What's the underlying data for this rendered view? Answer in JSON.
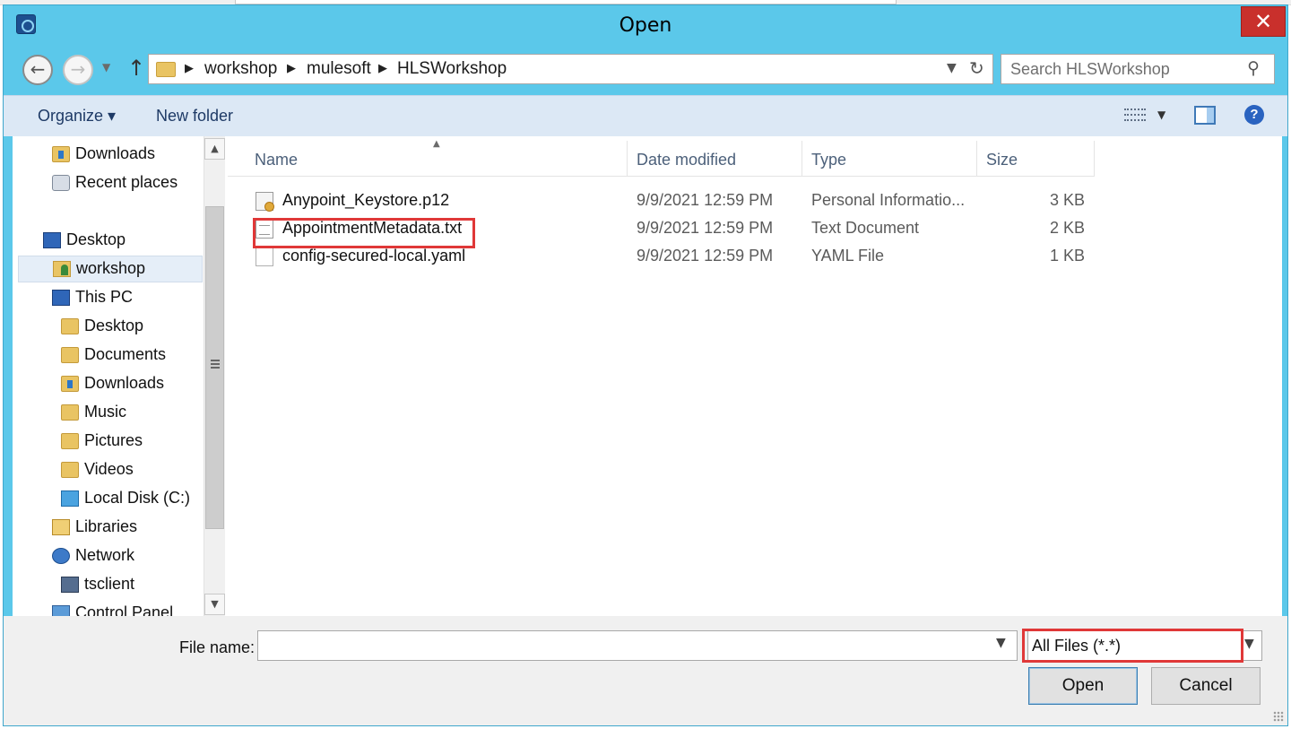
{
  "window": {
    "title": "Open",
    "close_symbol": "✕"
  },
  "address": {
    "breadcrumbs": [
      "workshop",
      "mulesoft",
      "HLSWorkshop"
    ],
    "search_placeholder": "Search HLSWorkshop"
  },
  "toolbar": {
    "organize_label": "Organize ▾",
    "new_folder_label": "New folder",
    "help_label": "?"
  },
  "nav": {
    "items": [
      {
        "label": "Downloads",
        "icon": "downloads-folder-icon"
      },
      {
        "label": "Recent places",
        "icon": "recent-places-icon"
      },
      {
        "label": "Desktop",
        "icon": "desktop-icon"
      },
      {
        "label": "workshop",
        "icon": "user-folder-icon",
        "selected": true
      },
      {
        "label": "This PC",
        "icon": "computer-icon"
      },
      {
        "label": "Desktop",
        "icon": "folder-icon"
      },
      {
        "label": "Documents",
        "icon": "folder-icon"
      },
      {
        "label": "Downloads",
        "icon": "downloads-folder-icon"
      },
      {
        "label": "Music",
        "icon": "folder-icon"
      },
      {
        "label": "Pictures",
        "icon": "folder-icon"
      },
      {
        "label": "Videos",
        "icon": "folder-icon"
      },
      {
        "label": "Local Disk (C:)",
        "icon": "disk-icon"
      },
      {
        "label": "Libraries",
        "icon": "libraries-icon"
      },
      {
        "label": "Network",
        "icon": "network-icon"
      },
      {
        "label": "tsclient",
        "icon": "tsclient-icon"
      },
      {
        "label": "Control Panel",
        "icon": "control-panel-icon"
      }
    ]
  },
  "files": {
    "columns": [
      "Name",
      "Date modified",
      "Type",
      "Size"
    ],
    "rows": [
      {
        "name": "Anypoint_Keystore.p12",
        "date": "9/9/2021 12:59 PM",
        "type": "Personal Informatio...",
        "size": "3 KB",
        "icon": "certificate-file-icon"
      },
      {
        "name": "AppointmentMetadata.txt",
        "date": "9/9/2021 12:59 PM",
        "type": "Text Document",
        "size": "2 KB",
        "icon": "text-file-icon"
      },
      {
        "name": "config-secured-local.yaml",
        "date": "9/9/2021 12:59 PM",
        "type": "YAML File",
        "size": "1 KB",
        "icon": "yaml-file-icon"
      }
    ]
  },
  "bottom": {
    "file_name_label": "File name:",
    "file_name_value": "",
    "file_type_value": "All Files (*.*)",
    "open_label": "Open",
    "cancel_label": "Cancel"
  },
  "colors": {
    "title_bar": "#5bc8ea",
    "toolbar": "#dce8f5",
    "highlight": "#e03838",
    "close_button": "#c9302c"
  }
}
